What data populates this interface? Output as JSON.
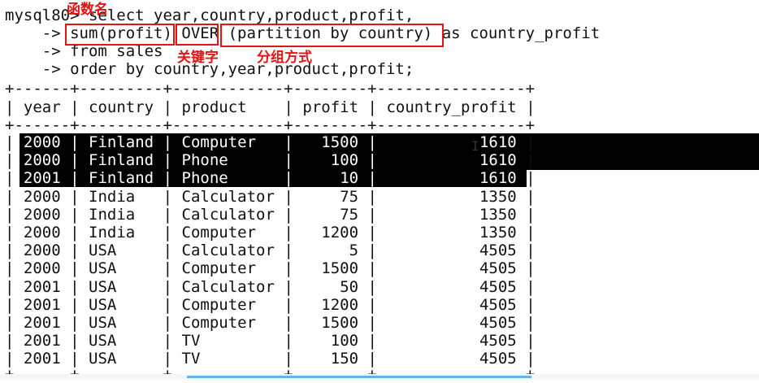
{
  "query": {
    "prompt": "mysql80>",
    "line1_rest": " select year,country,product,profit,",
    "line2_indent": "    -> ",
    "line2_func": "sum(profit)",
    "line2_keyword": "OVER",
    "line2_partition": "(partition by country)",
    "line2_alias": " as country_profit",
    "line3": "    -> from sales",
    "line4": "    -> order by country,year,product,profit;"
  },
  "annotations": {
    "func_name": "函数名",
    "keyword": "关键字",
    "partition_method": "分组方式"
  },
  "table": {
    "border_line": "+------+---------+------------+--------+----------------+",
    "columns": [
      "year",
      "country",
      "product",
      "profit",
      "country_profit"
    ],
    "rows": [
      {
        "year": "2000",
        "country": "Finland",
        "product": "Computer",
        "profit": "1500",
        "country_profit": "1610",
        "selected": true
      },
      {
        "year": "2000",
        "country": "Finland",
        "product": "Phone",
        "profit": "100",
        "country_profit": "1610",
        "selected": true
      },
      {
        "year": "2001",
        "country": "Finland",
        "product": "Phone",
        "profit": "10",
        "country_profit": "1610",
        "selected": true
      },
      {
        "year": "2000",
        "country": "India",
        "product": "Calculator",
        "profit": "75",
        "country_profit": "1350",
        "selected": false
      },
      {
        "year": "2000",
        "country": "India",
        "product": "Calculator",
        "profit": "75",
        "country_profit": "1350",
        "selected": false
      },
      {
        "year": "2000",
        "country": "India",
        "product": "Computer",
        "profit": "1200",
        "country_profit": "1350",
        "selected": false
      },
      {
        "year": "2000",
        "country": "USA",
        "product": "Calculator",
        "profit": "5",
        "country_profit": "4505",
        "selected": false
      },
      {
        "year": "2000",
        "country": "USA",
        "product": "Computer",
        "profit": "1500",
        "country_profit": "4505",
        "selected": false
      },
      {
        "year": "2001",
        "country": "USA",
        "product": "Calculator",
        "profit": "50",
        "country_profit": "4505",
        "selected": false
      },
      {
        "year": "2001",
        "country": "USA",
        "product": "Computer",
        "profit": "1200",
        "country_profit": "4505",
        "selected": false
      },
      {
        "year": "2001",
        "country": "USA",
        "product": "Computer",
        "profit": "1500",
        "country_profit": "4505",
        "selected": false
      },
      {
        "year": "2001",
        "country": "USA",
        "product": "TV",
        "profit": "100",
        "country_profit": "4505",
        "selected": false
      },
      {
        "year": "2001",
        "country": "USA",
        "product": "TV",
        "profit": "150",
        "country_profit": "4505",
        "selected": false
      }
    ]
  },
  "cursor": "I",
  "colors": {
    "annotation": "#e01515",
    "selection": "#000000",
    "scrollbar": "#64b0f2"
  }
}
